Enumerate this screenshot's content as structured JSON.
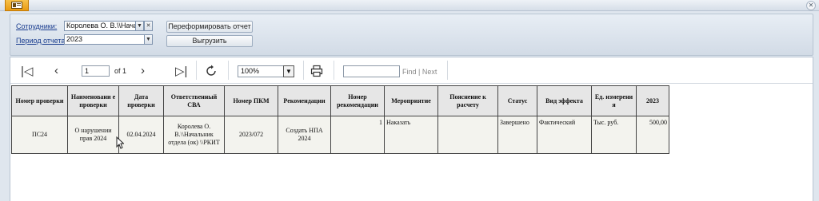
{
  "params": {
    "employee_label": "Сотрудники:",
    "employee_value": "Королева О. В.\\\\Начальн",
    "period_label": "Период отчета:",
    "period_value": "2023",
    "reformat_button": "Переформировать отчет",
    "export_button": "Выгрузить"
  },
  "toolbar": {
    "page_value": "1",
    "of_pages": "of 1",
    "zoom": "100%",
    "find_label": "Find",
    "find_sep": "|",
    "next_label": "Next"
  },
  "table": {
    "headers": [
      "Номер проверки",
      "Наименовани е проверки",
      "Дата проверки",
      "Ответственный СВА",
      "Номер ПКМ",
      "Рекомендации",
      "Номер рекомендации",
      "Мероприятие",
      "Пояснение к расчету",
      "Статус",
      "Вид эффекта",
      "Ед. измерени я",
      "2023"
    ],
    "rows": [
      [
        "ПС24",
        "О нарушении прав 2024",
        "02.04.2024",
        "Королева О. В.\\\\Начальник отдела (ок) \\\\РКИТ",
        "2023/072",
        "Создать НПА 2024",
        "1",
        "Наказать",
        "",
        "Завершено",
        "Фактический",
        "Тыс. руб.",
        "500,00"
      ]
    ]
  },
  "colors": {
    "accent": "#f0a11c",
    "link": "#1a3d8f",
    "header_bg": "#e6e6e6"
  }
}
